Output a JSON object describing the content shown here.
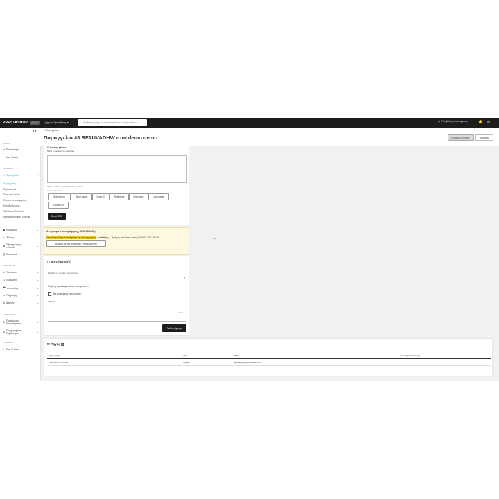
{
  "topbar": {
    "logo": "PRESTASHOP",
    "version": "9.0.0",
    "quick_access": "Γρήγορη Πρόσβαση",
    "search_placeholder": "Αναζήτηση (π.χ.: κωδικός προϊόντος, όνομα πελάτη...)",
    "view_shop": "Προβολή καταστήματος",
    "notif_count": "1"
  },
  "sidebar": {
    "collapse": "❮❮",
    "sections": {
      "welcome": "ΚΑΛΩΣ",
      "sales": "ΠΩΛΗΣΕΙΣ",
      "catalog": "ΚΑΤΑΛΟΓΟΣ",
      "configure": "ΔΙΑΜΟΡΦΩΣΗ",
      "community": "COMMUNITY"
    },
    "items": {
      "dashboard": "Επισκόπηση",
      "carecenter": "Care Center",
      "orders": "Παραγγελίες",
      "orders_sub": [
        "Παραγγελίες",
        "Παραστατικά",
        "Πιστωτικά δελτία",
        "Στοιχεία σε μεταφορικής",
        "Καλάθια Αγορών",
        "Withdrawal Requests",
        "Withdrawal Button Settings"
      ],
      "catalog": "Κατάλογος",
      "customers": "Πελάτες",
      "service": "Εξυπηρέτηση πελατών",
      "stats": "Στατιστικά",
      "modules": "Πρόσθετα",
      "appearance": "Εμφάνιση",
      "shipping": "Αποστολή",
      "payment": "Πληρωμή",
      "international": "Διεθνής",
      "shop_params": "Παράμετροι Καταστήματος",
      "adv_params": "Προχωρημένες Παράμετροι",
      "wall": "Wall of Fame"
    }
  },
  "header": {
    "breadcrumb": "Παραγγελίες",
    "title": "Παραγγελία #8 RFAUVADHW από demo demo",
    "print_btn": "Προβολή κλεισών",
    "help_btn": "Βοήθεια"
  },
  "sms": {
    "customer_phone_label": "Customer phone:",
    "send_msg_label": "Send a message to customer:",
    "counter": "0/917 · 0/160 · Μηνύματα: 0/6 · 1 SMS",
    "insert_vars": "Insert variables:",
    "var_buttons": [
      "Shipping no",
      "Shop name",
      "Order ID",
      "Reference",
      "First name",
      "Last name",
      "Tracking Url"
    ],
    "send_btn": "Send SMS"
  },
  "withdrawal": {
    "title": "Αντίγραφο Υπαναχώρησης (Ν.5217/2026)",
    "highlight": "Οι πελάτης έλαβε το αντίγραφο της υπαναχώρησης",
    "detail_bold": "Αποδείξεις",
    "detail_rest": "— Αριθμός: ord-demo-demo (2026-06-10 17:59:19)",
    "button": "Άνοιγμα σε νέα Αντίγραφο Υπαναχώρησης"
  },
  "messages": {
    "title": "Μηνύματα (0)",
    "select_label": "Επιλέξτε το μήνυμα παραγγελίας",
    "configure_link": "Ρύθμιση προκαθορισμένων μηνυμάτων",
    "checkbox_label": "Να εμφανίζεται στον πελάτη;",
    "message_label": "Μήνυμα",
    "char_count": "1200",
    "send_btn": "Στείλε μήνυμα"
  },
  "emails": {
    "title": "Πηγές",
    "count": "1",
    "headers": [
      "Ημερομηνία",
      "από",
      "Θέμα",
      "Αλλαγή κατάστασης"
    ],
    "rows": [
      [
        "2026-06-10 17:59:19",
        "Προφίλ",
        "prestashop@prestashop.com",
        ""
      ]
    ]
  }
}
